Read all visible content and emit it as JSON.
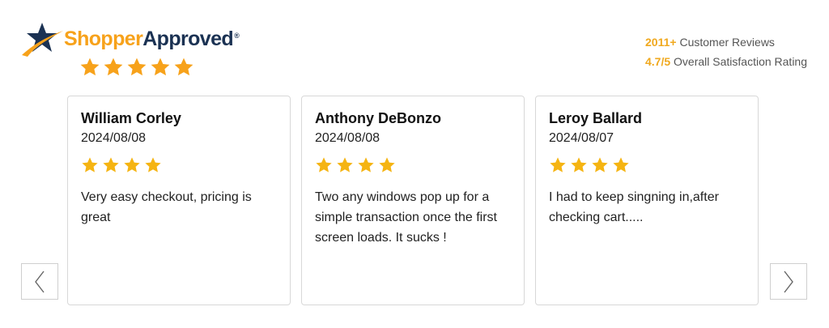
{
  "brand": {
    "part1": "Shopper",
    "part2": "Approved",
    "reg": "®",
    "rating_stars": 5,
    "logo_icon": "star-swoosh-icon",
    "colors": {
      "orange": "#f7a21b",
      "navy": "#1b3253"
    }
  },
  "summary": {
    "review_count": "2011+",
    "review_label": "Customer Reviews",
    "rating": "4.7/5",
    "rating_label": "Overall Satisfaction Rating",
    "highlight_color": "#f0a81d"
  },
  "navigation": {
    "prev_icon": "chevron-left-icon",
    "next_icon": "chevron-right-icon"
  },
  "reviews": [
    {
      "name": "William Corley",
      "date": "2024/08/08",
      "stars": 4,
      "text": "Very easy checkout, pricing is great"
    },
    {
      "name": "Anthony DeBonzo",
      "date": "2024/08/08",
      "stars": 4,
      "text": "Two any windows pop up for a simple transaction once the first screen loads. It sucks !"
    },
    {
      "name": "Leroy Ballard",
      "date": "2024/08/07",
      "stars": 4,
      "text": "I had to keep singning in,after checking cart....."
    }
  ],
  "star_color": "#f5b412"
}
